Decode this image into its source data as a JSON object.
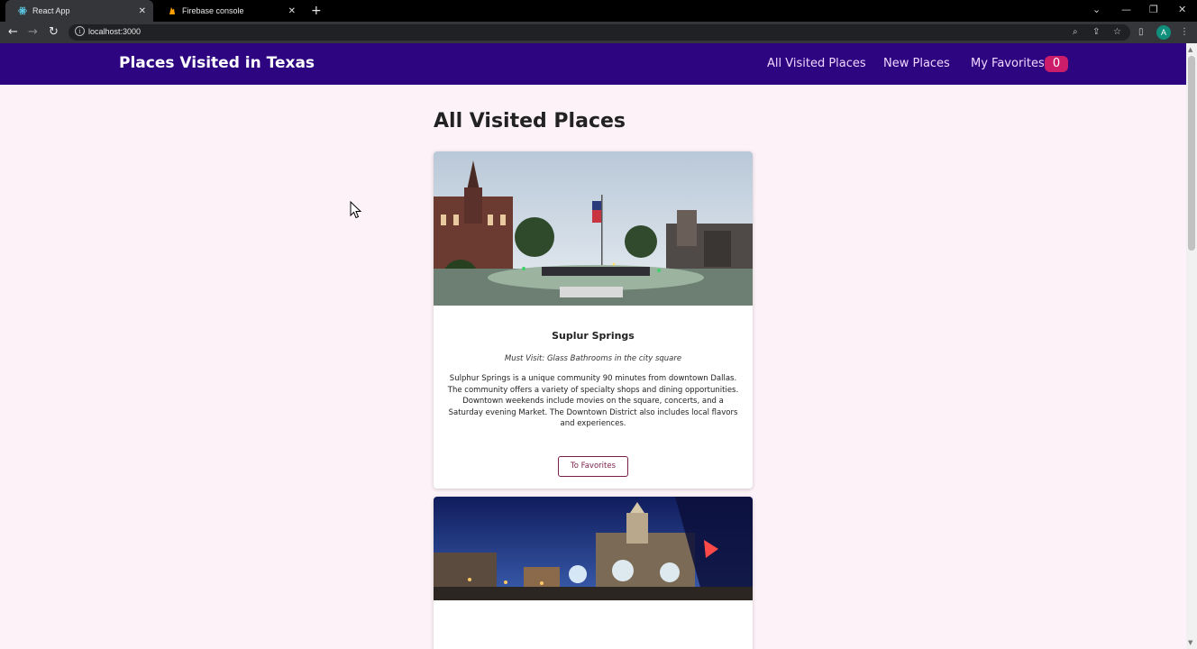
{
  "browser": {
    "tabs": [
      {
        "title": "React App"
      },
      {
        "title": "Firebase console"
      }
    ],
    "new_tab_glyph": "+",
    "close_glyph": "✕",
    "url": "localhost:3000"
  },
  "app": {
    "logo": "Places Visited in Texas",
    "nav": {
      "all": "All Visited Places",
      "new": "New Places",
      "favorites": "My Favorites",
      "favorites_count": "0"
    },
    "section_title": "All Visited Places",
    "cards": [
      {
        "title": "Suplur Springs",
        "subtitle": "Must Visit: Glass Bathrooms in the city square",
        "description": "Sulphur Springs is a unique community 90 minutes from downtown Dallas. The community offers a variety of specialty shops and dining opportunities. Downtown weekends include movies on the square, concerts, and a Saturday evening Market. The Downtown District also includes local flavors and experiences.",
        "button": "To Favorites"
      }
    ]
  },
  "colors": {
    "header_bg": "#2d0581",
    "page_bg": "#fcf2f7",
    "badge_bg": "#cc1d6a",
    "button_accent": "#7a1f4a"
  }
}
